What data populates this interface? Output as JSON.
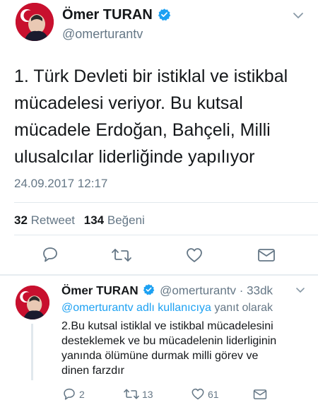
{
  "main_tweet": {
    "author_name": "Ömer TURAN",
    "author_handle": "@omerturantv",
    "text_lines": [
      "1. Türk Devleti bir istiklal ve istikbal",
      "mücadelesi veriyor. Bu kutsal",
      "mücadele Erdoğan, Bahçeli, Milli",
      "ulusalcılar liderliğinde yapılıyor"
    ],
    "timestamp": "24.09.2017 12:17",
    "retweet_count": "32",
    "retweet_label": "Retweet",
    "like_count": "134",
    "like_label": "Beğeni"
  },
  "reply_tweet": {
    "author_name": "Ömer TURAN",
    "author_handle": "@omerturantv",
    "time": "· 33dk",
    "replying_to_handle": "@omerturantv adlı kullanıcıya",
    "replying_to_suffix": "yanıt olarak",
    "text_lines": [
      "2.Bu kutsal istiklal ve istikbal mücadelesini",
      "desteklemek ve bu mücadelenin liderliginin",
      "yanında ölümüne durmak milli görev ve",
      "dinen farzdır"
    ],
    "reply_count": "2",
    "retweet_count": "13",
    "like_count": "61"
  },
  "colors": {
    "accent": "#1da1f2",
    "text": "#14171a",
    "muted": "#657786",
    "icon": "#657786",
    "divider": "#e1e8ed"
  },
  "icons": {
    "verified": "verified-badge-icon",
    "reply": "reply-icon",
    "retweet": "retweet-icon",
    "like": "heart-icon",
    "dm": "envelope-icon",
    "more": "chevron-down-icon"
  }
}
